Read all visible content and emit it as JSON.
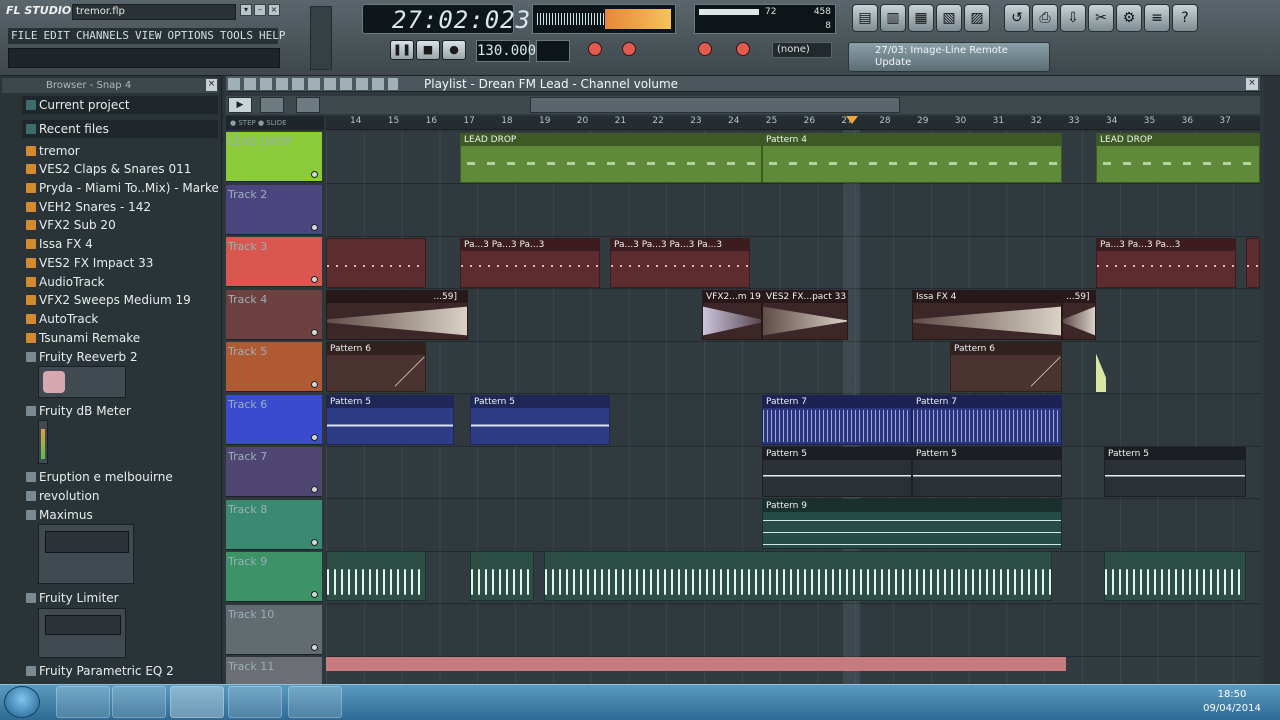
{
  "app": {
    "logo": "FL STUDIO",
    "filename": "tremor.flp"
  },
  "menu": [
    "FILE",
    "EDIT",
    "CHANNELS",
    "VIEW",
    "OPTIONS",
    "TOOLS",
    "HELP"
  ],
  "transport": {
    "time": "27:02:023",
    "tempo": "130.000",
    "pattern_select": "(none)",
    "cpu": "72",
    "poly": "458",
    "voices": "8"
  },
  "news": {
    "text": "27/03: Image-Line Remote Update"
  },
  "browser": {
    "title": "Browser - Snap 4",
    "items": [
      {
        "label": "Current project",
        "kind": "folder"
      },
      {
        "label": "Recent files",
        "kind": "folder"
      },
      {
        "label": "tremor",
        "kind": "file"
      },
      {
        "label": "VES2 Claps & Snares 011",
        "kind": "file"
      },
      {
        "label": "Pryda - Miami To..Mix) - Marker #2_3",
        "kind": "file"
      },
      {
        "label": "VEH2 Snares - 142",
        "kind": "file"
      },
      {
        "label": "VFX2 Sub 20",
        "kind": "file"
      },
      {
        "label": "Issa FX 4",
        "kind": "file"
      },
      {
        "label": "VES2 FX Impact 33",
        "kind": "file"
      },
      {
        "label": "AudioTrack",
        "kind": "file"
      },
      {
        "label": "VFX2 Sweeps Medium 19",
        "kind": "file"
      },
      {
        "label": "AutoTrack",
        "kind": "file"
      },
      {
        "label": "Tsunami Remake",
        "kind": "file"
      },
      {
        "label": "Fruity Reeverb 2",
        "kind": "plugin"
      },
      {
        "label": "Fruity dB Meter",
        "kind": "plugin"
      },
      {
        "label": "Eruption e melbouirne",
        "kind": "plugin"
      },
      {
        "label": "revolution",
        "kind": "plugin"
      },
      {
        "label": "Maximus",
        "kind": "plugin"
      },
      {
        "label": "Fruity Limiter",
        "kind": "plugin"
      },
      {
        "label": "Fruity Parametric EQ 2",
        "kind": "plugin"
      }
    ]
  },
  "playlist": {
    "title": "Playlist - Drean FM Lead - Channel volume",
    "step_label": "STEP",
    "slide_label": "SLIDE",
    "ruler": [
      "14",
      "15",
      "16",
      "17",
      "18",
      "19",
      "20",
      "21",
      "22",
      "23",
      "24",
      "25",
      "26",
      "27",
      "28",
      "29",
      "30",
      "31",
      "32",
      "33",
      "34",
      "35",
      "36",
      "37"
    ],
    "tracks": [
      "LEAD DROP",
      "Track 2",
      "Track 3",
      "Track 4",
      "Track 5",
      "Track 6",
      "Track 7",
      "Track 8",
      "Track 9",
      "Track 10",
      "Track 11"
    ],
    "track_colors": [
      "#8ccc3a",
      "#4c4580",
      "#d9574f",
      "#6e4141",
      "#b05a33",
      "#3a4bd0",
      "#4f4673",
      "#3a8a72",
      "#3b9366",
      "#616b70",
      "#6b6f74"
    ],
    "clips": {
      "lead1": "LEAD DROP",
      "lead2": "Pattern 4",
      "lead3": "LEAD DROP",
      "t3a": "Pa...3",
      "t3b": "Pa...3",
      "t3c": "Pa...3",
      "t3d": "Pa...3",
      "t3e": "Pa...3",
      "t3f": "Pa...3",
      "t3g": "Pa...3",
      "t3h": "Pa...3",
      "t3i": "Pa...3",
      "t3j": "Pa...3",
      "t4a": "...59]",
      "t4b": "VFX2...m 19",
      "t4c": "VES2 FX...pact 33",
      "t4d": "Issa FX 4",
      "t4e": "...59]",
      "t5a": "Pattern 6",
      "t5b": "Pattern 6",
      "t6a": "Pattern 5",
      "t6b": "Pattern 5",
      "t6c": "Pattern 7",
      "t6d": "Pattern 7",
      "t7a": "Pattern 5",
      "t7b": "Pattern 5",
      "t7c": "Pattern 5",
      "t8a": "Pattern 9"
    }
  },
  "taskbar": {
    "time": "18:50",
    "date": "09/04/2014"
  }
}
